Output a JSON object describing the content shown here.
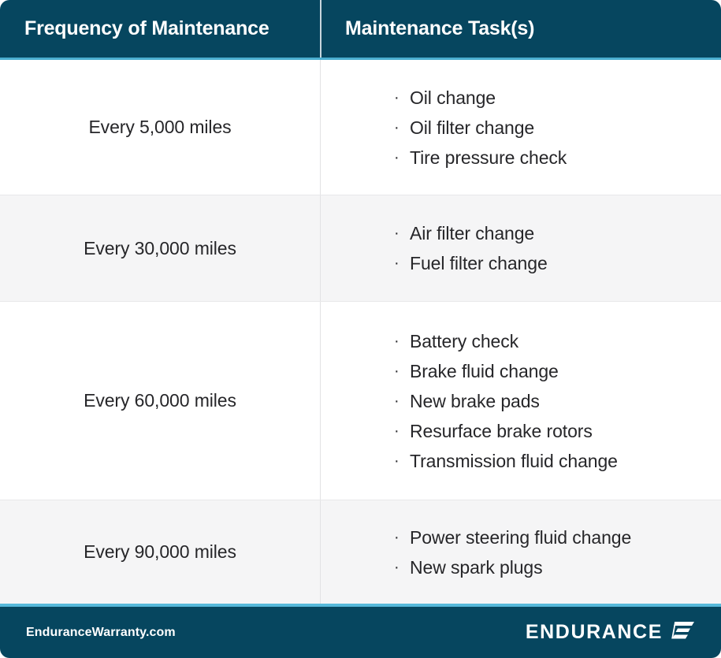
{
  "table": {
    "headers": {
      "frequency": "Frequency of Maintenance",
      "tasks": "Maintenance Task(s)"
    },
    "rows": [
      {
        "frequency": "Every 5,000 miles",
        "tasks": [
          "Oil change",
          "Oil filter change",
          "Tire pressure check"
        ]
      },
      {
        "frequency": "Every 30,000 miles",
        "tasks": [
          "Air filter change",
          "Fuel filter change"
        ]
      },
      {
        "frequency": "Every 60,000 miles",
        "tasks": [
          "Battery check",
          "Brake fluid change",
          "New brake pads",
          "Resurface brake rotors",
          "Transmission fluid change"
        ]
      },
      {
        "frequency": "Every 90,000 miles",
        "tasks": [
          "Power steering fluid change",
          "New spark plugs"
        ]
      }
    ],
    "bullet_glyph": "·"
  },
  "footer": {
    "site": "EnduranceWarranty.com",
    "brand": "ENDURANCE",
    "logo_icon": "endurance-wing-mark"
  },
  "colors": {
    "header_bg": "#06465f",
    "accent_line": "#4aaed0",
    "row_shaded_bg": "#f5f5f6",
    "row_plain_bg": "#ffffff",
    "text": "#262629"
  }
}
